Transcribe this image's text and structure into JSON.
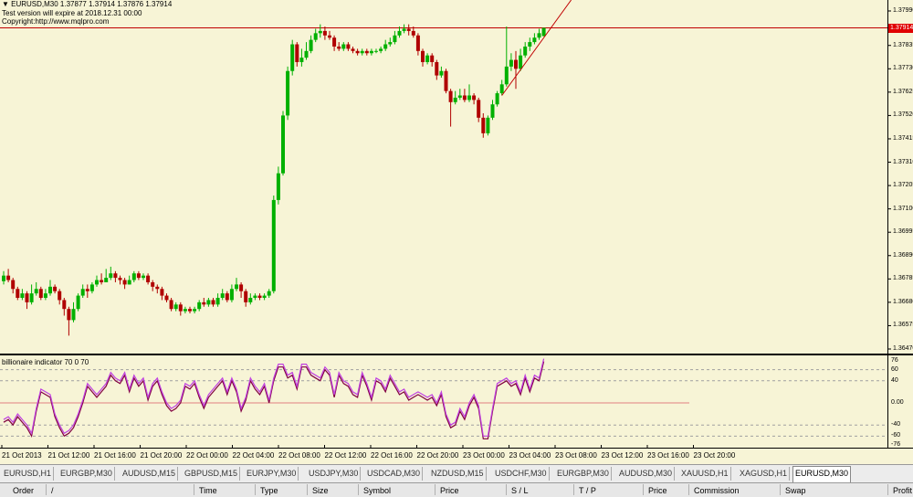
{
  "chart": {
    "header_line": "▼ EURUSD,M30  1.37877 1.37914 1.37876 1.37914",
    "notice_line": "Test version will expire at 2018.12.31 00:00",
    "copyright_line": "Copyright:http://www.mqlpro.com",
    "current_price_label": "1.37914",
    "price_axis_labels": [
      "1.37990",
      "1.37835",
      "1.37730",
      "1.37625",
      "1.37520",
      "1.37415",
      "1.37310",
      "1.37205",
      "1.37100",
      "1.36995",
      "1.36890",
      "1.36785",
      "1.36680",
      "1.36575",
      "1.36470"
    ],
    "indicator_title": "billionaire indicator 70 0 70",
    "indicator_axis_labels": [
      "76",
      "60",
      "40",
      "0.00",
      "-40",
      "-60",
      "-76"
    ],
    "time_labels": [
      "21 Oct 2013",
      "21 Oct 12:00",
      "21 Oct 16:00",
      "21 Oct 20:00",
      "22 Oct 00:00",
      "22 Oct 04:00",
      "22 Oct 08:00",
      "22 Oct 12:00",
      "22 Oct 16:00",
      "22 Oct 20:00",
      "23 Oct 00:00",
      "23 Oct 04:00",
      "23 Oct 08:00",
      "23 Oct 12:00",
      "23 Oct 16:00",
      "23 Oct 20:00"
    ],
    "colors": {
      "bull": "#00b000",
      "bear": "#b00000",
      "indicator_a": "#c040e0",
      "indicator_b": "#800040",
      "price_line": "#c00000"
    }
  },
  "candles": [
    {
      "o": 1.36775,
      "c": 1.368,
      "h": 1.3682,
      "l": 1.3676
    },
    {
      "o": 1.368,
      "c": 1.3678,
      "h": 1.3683,
      "l": 1.3677
    },
    {
      "o": 1.3678,
      "c": 1.3674,
      "h": 1.3679,
      "l": 1.3672
    },
    {
      "o": 1.3674,
      "c": 1.367,
      "h": 1.3675,
      "l": 1.3669
    },
    {
      "o": 1.367,
      "c": 1.3672,
      "h": 1.3674,
      "l": 1.3669
    },
    {
      "o": 1.3672,
      "c": 1.3668,
      "h": 1.3673,
      "l": 1.3665
    },
    {
      "o": 1.3668,
      "c": 1.3672,
      "h": 1.3676,
      "l": 1.3667
    },
    {
      "o": 1.3672,
      "c": 1.3674,
      "h": 1.3677,
      "l": 1.3671
    },
    {
      "o": 1.3674,
      "c": 1.367,
      "h": 1.3675,
      "l": 1.3669
    },
    {
      "o": 1.367,
      "c": 1.3672,
      "h": 1.3674,
      "l": 1.3669
    },
    {
      "o": 1.3672,
      "c": 1.3675,
      "h": 1.3678,
      "l": 1.3671
    },
    {
      "o": 1.3675,
      "c": 1.3673,
      "h": 1.3676,
      "l": 1.3672
    },
    {
      "o": 1.3673,
      "c": 1.3669,
      "h": 1.3674,
      "l": 1.3667
    },
    {
      "o": 1.3669,
      "c": 1.3665,
      "h": 1.367,
      "l": 1.3662
    },
    {
      "o": 1.3665,
      "c": 1.366,
      "h": 1.3666,
      "l": 1.3653
    },
    {
      "o": 1.366,
      "c": 1.3665,
      "h": 1.3668,
      "l": 1.3659
    },
    {
      "o": 1.3665,
      "c": 1.3671,
      "h": 1.3672,
      "l": 1.3664
    },
    {
      "o": 1.3671,
      "c": 1.3674,
      "h": 1.3676,
      "l": 1.367
    },
    {
      "o": 1.3674,
      "c": 1.3673,
      "h": 1.3676,
      "l": 1.367
    },
    {
      "o": 1.3673,
      "c": 1.3676,
      "h": 1.3677,
      "l": 1.3672
    },
    {
      "o": 1.3676,
      "c": 1.3678,
      "h": 1.368,
      "l": 1.3675
    },
    {
      "o": 1.3678,
      "c": 1.3677,
      "h": 1.3681,
      "l": 1.3676
    },
    {
      "o": 1.3677,
      "c": 1.3679,
      "h": 1.3683,
      "l": 1.3677
    },
    {
      "o": 1.3679,
      "c": 1.3681,
      "h": 1.3684,
      "l": 1.3678
    },
    {
      "o": 1.3681,
      "c": 1.3679,
      "h": 1.3682,
      "l": 1.3677
    },
    {
      "o": 1.3679,
      "c": 1.3678,
      "h": 1.368,
      "l": 1.3676
    },
    {
      "o": 1.3678,
      "c": 1.3676,
      "h": 1.3679,
      "l": 1.3674
    },
    {
      "o": 1.3676,
      "c": 1.3678,
      "h": 1.368,
      "l": 1.3676
    },
    {
      "o": 1.3678,
      "c": 1.3681,
      "h": 1.3682,
      "l": 1.3677
    },
    {
      "o": 1.3681,
      "c": 1.3679,
      "h": 1.3682,
      "l": 1.3678
    },
    {
      "o": 1.3679,
      "c": 1.368,
      "h": 1.3681,
      "l": 1.3678
    },
    {
      "o": 1.368,
      "c": 1.3677,
      "h": 1.3681,
      "l": 1.3676
    },
    {
      "o": 1.3677,
      "c": 1.3675,
      "h": 1.3678,
      "l": 1.3673
    },
    {
      "o": 1.3675,
      "c": 1.3674,
      "h": 1.3676,
      "l": 1.3672
    },
    {
      "o": 1.3674,
      "c": 1.3671,
      "h": 1.3675,
      "l": 1.3669
    },
    {
      "o": 1.3671,
      "c": 1.3669,
      "h": 1.3672,
      "l": 1.3668
    },
    {
      "o": 1.3669,
      "c": 1.3665,
      "h": 1.367,
      "l": 1.3664
    },
    {
      "o": 1.3665,
      "c": 1.3667,
      "h": 1.3668,
      "l": 1.3664
    },
    {
      "o": 1.3667,
      "c": 1.3664,
      "h": 1.3668,
      "l": 1.3662
    },
    {
      "o": 1.3664,
      "c": 1.3665,
      "h": 1.3666,
      "l": 1.3663
    },
    {
      "o": 1.3665,
      "c": 1.3664,
      "h": 1.3666,
      "l": 1.3663
    },
    {
      "o": 1.3664,
      "c": 1.3665,
      "h": 1.3666,
      "l": 1.3663
    },
    {
      "o": 1.3665,
      "c": 1.3668,
      "h": 1.3669,
      "l": 1.3664
    },
    {
      "o": 1.3668,
      "c": 1.3667,
      "h": 1.367,
      "l": 1.3666
    },
    {
      "o": 1.3667,
      "c": 1.3669,
      "h": 1.367,
      "l": 1.3666
    },
    {
      "o": 1.3669,
      "c": 1.3667,
      "h": 1.367,
      "l": 1.3666
    },
    {
      "o": 1.3667,
      "c": 1.367,
      "h": 1.3672,
      "l": 1.3666
    },
    {
      "o": 1.367,
      "c": 1.3672,
      "h": 1.3674,
      "l": 1.3669
    },
    {
      "o": 1.3672,
      "c": 1.3669,
      "h": 1.3673,
      "l": 1.3668
    },
    {
      "o": 1.3669,
      "c": 1.3674,
      "h": 1.3676,
      "l": 1.3668
    },
    {
      "o": 1.3674,
      "c": 1.3676,
      "h": 1.3679,
      "l": 1.3673
    },
    {
      "o": 1.3676,
      "c": 1.3673,
      "h": 1.3677,
      "l": 1.367
    },
    {
      "o": 1.3673,
      "c": 1.3668,
      "h": 1.3674,
      "l": 1.3666
    },
    {
      "o": 1.3668,
      "c": 1.367,
      "h": 1.3672,
      "l": 1.3667
    },
    {
      "o": 1.367,
      "c": 1.3671,
      "h": 1.3672,
      "l": 1.3669
    },
    {
      "o": 1.3671,
      "c": 1.367,
      "h": 1.3672,
      "l": 1.3669
    },
    {
      "o": 1.367,
      "c": 1.3671,
      "h": 1.3672,
      "l": 1.3669
    },
    {
      "o": 1.3671,
      "c": 1.3673,
      "h": 1.3674,
      "l": 1.367
    },
    {
      "o": 1.3673,
      "c": 1.3714,
      "h": 1.3716,
      "l": 1.3672
    },
    {
      "o": 1.3714,
      "c": 1.3726,
      "h": 1.3729,
      "l": 1.3712
    },
    {
      "o": 1.3726,
      "c": 1.3752,
      "h": 1.3754,
      "l": 1.3725
    },
    {
      "o": 1.3752,
      "c": 1.3772,
      "h": 1.3774,
      "l": 1.375
    },
    {
      "o": 1.3772,
      "c": 1.3784,
      "h": 1.3786,
      "l": 1.377
    },
    {
      "o": 1.3784,
      "c": 1.3776,
      "h": 1.3785,
      "l": 1.3774
    },
    {
      "o": 1.3776,
      "c": 1.3778,
      "h": 1.3782,
      "l": 1.3774
    },
    {
      "o": 1.3778,
      "c": 1.3781,
      "h": 1.3785,
      "l": 1.3777
    },
    {
      "o": 1.3781,
      "c": 1.3786,
      "h": 1.3788,
      "l": 1.378
    },
    {
      "o": 1.3786,
      "c": 1.3789,
      "h": 1.3791,
      "l": 1.3785
    },
    {
      "o": 1.3789,
      "c": 1.379,
      "h": 1.3793,
      "l": 1.3787
    },
    {
      "o": 1.379,
      "c": 1.3788,
      "h": 1.3792,
      "l": 1.3786
    },
    {
      "o": 1.3788,
      "c": 1.3787,
      "h": 1.379,
      "l": 1.3786
    },
    {
      "o": 1.3787,
      "c": 1.3783,
      "h": 1.3788,
      "l": 1.3781
    },
    {
      "o": 1.3783,
      "c": 1.3782,
      "h": 1.3785,
      "l": 1.3781
    },
    {
      "o": 1.3782,
      "c": 1.3784,
      "h": 1.3785,
      "l": 1.3781
    },
    {
      "o": 1.3784,
      "c": 1.3782,
      "h": 1.3785,
      "l": 1.3781
    },
    {
      "o": 1.3782,
      "c": 1.3781,
      "h": 1.3783,
      "l": 1.378
    },
    {
      "o": 1.3781,
      "c": 1.378,
      "h": 1.3782,
      "l": 1.3779
    },
    {
      "o": 1.378,
      "c": 1.3781,
      "h": 1.3782,
      "l": 1.3779
    },
    {
      "o": 1.3781,
      "c": 1.378,
      "h": 1.3782,
      "l": 1.3779
    },
    {
      "o": 1.378,
      "c": 1.3781,
      "h": 1.3782,
      "l": 1.3779
    },
    {
      "o": 1.3781,
      "c": 1.3781,
      "h": 1.3782,
      "l": 1.378
    },
    {
      "o": 1.3781,
      "c": 1.3782,
      "h": 1.3783,
      "l": 1.378
    },
    {
      "o": 1.3782,
      "c": 1.3784,
      "h": 1.3786,
      "l": 1.3781
    },
    {
      "o": 1.3784,
      "c": 1.3785,
      "h": 1.3787,
      "l": 1.3783
    },
    {
      "o": 1.3785,
      "c": 1.3788,
      "h": 1.379,
      "l": 1.3784
    },
    {
      "o": 1.3788,
      "c": 1.379,
      "h": 1.3792,
      "l": 1.3787
    },
    {
      "o": 1.379,
      "c": 1.3791,
      "h": 1.3793,
      "l": 1.3789
    },
    {
      "o": 1.3791,
      "c": 1.379,
      "h": 1.3793,
      "l": 1.3788
    },
    {
      "o": 1.379,
      "c": 1.3788,
      "h": 1.3792,
      "l": 1.3787
    },
    {
      "o": 1.3788,
      "c": 1.3781,
      "h": 1.3789,
      "l": 1.3779
    },
    {
      "o": 1.3781,
      "c": 1.3776,
      "h": 1.3782,
      "l": 1.3774
    },
    {
      "o": 1.3776,
      "c": 1.3779,
      "h": 1.378,
      "l": 1.3775
    },
    {
      "o": 1.3779,
      "c": 1.3776,
      "h": 1.378,
      "l": 1.3774
    },
    {
      "o": 1.3776,
      "c": 1.377,
      "h": 1.3777,
      "l": 1.3768
    },
    {
      "o": 1.377,
      "c": 1.3772,
      "h": 1.3774,
      "l": 1.3769
    },
    {
      "o": 1.3772,
      "c": 1.3763,
      "h": 1.3773,
      "l": 1.3762
    },
    {
      "o": 1.3763,
      "c": 1.3758,
      "h": 1.3764,
      "l": 1.3747
    },
    {
      "o": 1.3758,
      "c": 1.376,
      "h": 1.3763,
      "l": 1.3757
    },
    {
      "o": 1.376,
      "c": 1.3761,
      "h": 1.3764,
      "l": 1.3759
    },
    {
      "o": 1.3761,
      "c": 1.3759,
      "h": 1.3764,
      "l": 1.3758
    },
    {
      "o": 1.3759,
      "c": 1.3761,
      "h": 1.3766,
      "l": 1.3758
    },
    {
      "o": 1.3761,
      "c": 1.3759,
      "h": 1.3762,
      "l": 1.3757
    },
    {
      "o": 1.3759,
      "c": 1.3751,
      "h": 1.376,
      "l": 1.3749
    },
    {
      "o": 1.3751,
      "c": 1.3744,
      "h": 1.3753,
      "l": 1.3742
    },
    {
      "o": 1.3744,
      "c": 1.3751,
      "h": 1.3752,
      "l": 1.3743
    },
    {
      "o": 1.3751,
      "c": 1.3757,
      "h": 1.3759,
      "l": 1.375
    },
    {
      "o": 1.3757,
      "c": 1.3762,
      "h": 1.3763,
      "l": 1.3756
    },
    {
      "o": 1.3762,
      "c": 1.3766,
      "h": 1.3768,
      "l": 1.3761
    },
    {
      "o": 1.3766,
      "c": 1.3774,
      "h": 1.3792,
      "l": 1.3765
    },
    {
      "o": 1.3774,
      "c": 1.3777,
      "h": 1.378,
      "l": 1.3772
    },
    {
      "o": 1.3777,
      "c": 1.3773,
      "h": 1.3781,
      "l": 1.3764
    },
    {
      "o": 1.3773,
      "c": 1.3779,
      "h": 1.3782,
      "l": 1.3772
    },
    {
      "o": 1.3779,
      "c": 1.3783,
      "h": 1.3785,
      "l": 1.3778
    },
    {
      "o": 1.3783,
      "c": 1.3785,
      "h": 1.3787,
      "l": 1.3781
    },
    {
      "o": 1.3785,
      "c": 1.3787,
      "h": 1.3789,
      "l": 1.3784
    },
    {
      "o": 1.3787,
      "c": 1.3789,
      "h": 1.3791,
      "l": 1.3786
    },
    {
      "o": 1.37877,
      "c": 1.37914,
      "h": 1.37914,
      "l": 1.37876
    }
  ],
  "indicator": {
    "a": [
      -30,
      -25,
      -35,
      -20,
      -30,
      -40,
      -55,
      -10,
      25,
      20,
      15,
      -20,
      -40,
      -55,
      -50,
      -40,
      -20,
      5,
      35,
      25,
      15,
      25,
      35,
      55,
      45,
      40,
      55,
      25,
      50,
      35,
      45,
      10,
      35,
      45,
      20,
      0,
      -10,
      -5,
      5,
      35,
      30,
      40,
      15,
      -5,
      15,
      25,
      35,
      45,
      20,
      45,
      25,
      -10,
      10,
      45,
      30,
      20,
      35,
      5,
      45,
      70,
      70,
      50,
      55,
      30,
      70,
      70,
      55,
      50,
      45,
      65,
      55,
      15,
      55,
      40,
      35,
      20,
      15,
      55,
      35,
      10,
      45,
      40,
      25,
      50,
      35,
      20,
      25,
      10,
      15,
      20,
      15,
      10,
      15,
      0,
      20,
      -20,
      -40,
      -35,
      -10,
      -25,
      0,
      15,
      -5,
      -60,
      -60,
      -10,
      35,
      40,
      45,
      35,
      40,
      20,
      50,
      25,
      50,
      45,
      80
    ],
    "b": [
      -35,
      -30,
      -40,
      -25,
      -35,
      -45,
      -60,
      -15,
      20,
      15,
      10,
      -25,
      -45,
      -60,
      -55,
      -45,
      -25,
      0,
      30,
      20,
      10,
      20,
      30,
      50,
      40,
      35,
      50,
      20,
      45,
      30,
      40,
      5,
      30,
      40,
      15,
      -5,
      -15,
      -10,
      0,
      30,
      25,
      35,
      10,
      -10,
      10,
      20,
      30,
      40,
      15,
      40,
      20,
      -15,
      5,
      40,
      25,
      15,
      30,
      0,
      40,
      65,
      65,
      45,
      50,
      25,
      65,
      65,
      50,
      45,
      40,
      60,
      50,
      10,
      50,
      35,
      30,
      15,
      10,
      50,
      30,
      5,
      40,
      35,
      20,
      45,
      30,
      15,
      20,
      5,
      10,
      15,
      10,
      5,
      10,
      -5,
      15,
      -25,
      -45,
      -40,
      -15,
      -30,
      -5,
      10,
      -10,
      -65,
      -65,
      -15,
      30,
      35,
      40,
      30,
      35,
      15,
      45,
      20,
      45,
      40,
      75
    ]
  },
  "tabs": [
    {
      "label": "EURUSD,H1",
      "active": false
    },
    {
      "label": "EURGBP,M30",
      "active": false
    },
    {
      "label": "AUDUSD,M15",
      "active": false
    },
    {
      "label": "GBPUSD,M15",
      "active": false
    },
    {
      "label": "EURJPY,M30",
      "active": false
    },
    {
      "label": "USDJPY,M30",
      "active": false
    },
    {
      "label": "USDCAD,M30",
      "active": false
    },
    {
      "label": "NZDUSD,M15",
      "active": false
    },
    {
      "label": "USDCHF,M30",
      "active": false
    },
    {
      "label": "EURGBP,M30",
      "active": false
    },
    {
      "label": "AUDUSD,M30",
      "active": false
    },
    {
      "label": "XAUUSD,H1",
      "active": false
    },
    {
      "label": "XAGUSD,H1",
      "active": false
    },
    {
      "label": "EURUSD,M30",
      "active": true
    }
  ],
  "terminal_columns": [
    "Order",
    "/",
    "Time",
    "Type",
    "Size",
    "Symbol",
    "Price",
    "S / L",
    "T / P",
    "Price",
    "Commission",
    "Swap",
    "Profit"
  ]
}
